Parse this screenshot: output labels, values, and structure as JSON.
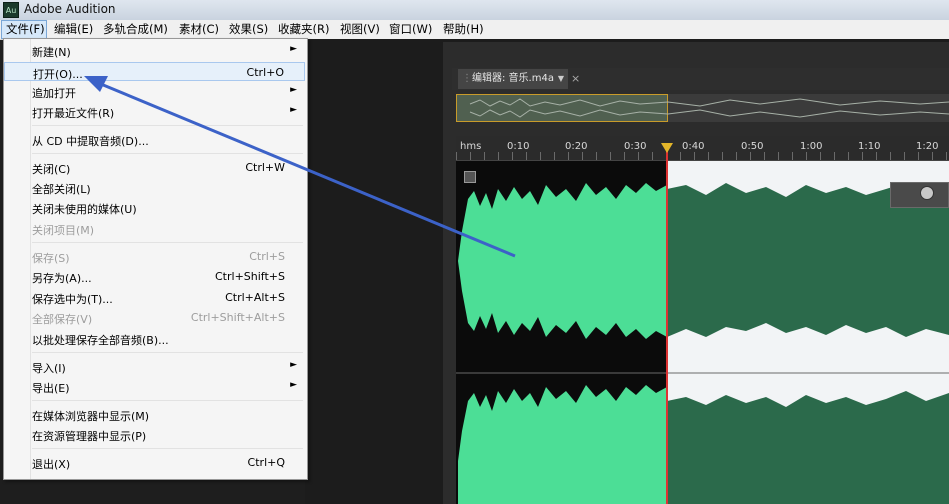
{
  "window": {
    "title": "Adobe Audition",
    "icon_text": "Au"
  },
  "menubar": [
    "文件(F)",
    "编辑(E)",
    "多轨合成(M)",
    "素材(C)",
    "效果(S)",
    "收藏夹(R)",
    "视图(V)",
    "窗口(W)",
    "帮助(H)"
  ],
  "file_menu": [
    {
      "label": "新建(N)",
      "submenu": true
    },
    {
      "label": "打开(O)...",
      "shortcut": "Ctrl+O",
      "highlighted": true
    },
    {
      "label": "追加打开",
      "submenu": true
    },
    {
      "label": "打开最近文件(R)",
      "submenu": true
    },
    {
      "label": "从 CD 中提取音频(D)..."
    },
    {
      "label": "关闭(C)",
      "shortcut": "Ctrl+W"
    },
    {
      "label": "全部关闭(L)"
    },
    {
      "label": "关闭未使用的媒体(U)"
    },
    {
      "label": "关闭项目(M)",
      "disabled": true
    },
    {
      "label": "保存(S)",
      "shortcut": "Ctrl+S",
      "disabled": true
    },
    {
      "label": "另存为(A)...",
      "shortcut": "Ctrl+Shift+S"
    },
    {
      "label": "保存选中为(T)...",
      "shortcut": "Ctrl+Alt+S"
    },
    {
      "label": "全部保存(V)",
      "shortcut": "Ctrl+Shift+Alt+S",
      "disabled": true
    },
    {
      "label": "以批处理保存全部音频(B)..."
    },
    {
      "label": "导入(I)",
      "submenu": true
    },
    {
      "label": "导出(E)",
      "submenu": true
    },
    {
      "label": "在媒体浏览器中显示(M)"
    },
    {
      "label": "在资源管理器中显示(P)"
    },
    {
      "label": "退出(X)",
      "shortcut": "Ctrl+Q"
    }
  ],
  "editor": {
    "tab_title": "编辑器: 音乐.m4a",
    "tab_menu": "▼",
    "tab_close": "×",
    "ruler_labels": [
      "hms",
      "0:10",
      "0:20",
      "0:30",
      "0:40",
      "0:50",
      "1:00",
      "1:10",
      "1:20"
    ]
  },
  "colors": {
    "waveform_selected": "#4cde96",
    "waveform": "#2b6a4b",
    "selection_background": "#0b0b0b",
    "unselected_background": "#f2f4f6",
    "annotation_arrow": "#3c62c8",
    "playhead_cap": "#e2b52a"
  },
  "icons": {
    "app": "audition-logo-icon",
    "submenu": "chevron-right-icon",
    "tab_grip": "grip-icon",
    "tab_menu": "dropdown-arrow-icon",
    "tab_close": "close-icon",
    "hud": "volume-knob-icon"
  }
}
